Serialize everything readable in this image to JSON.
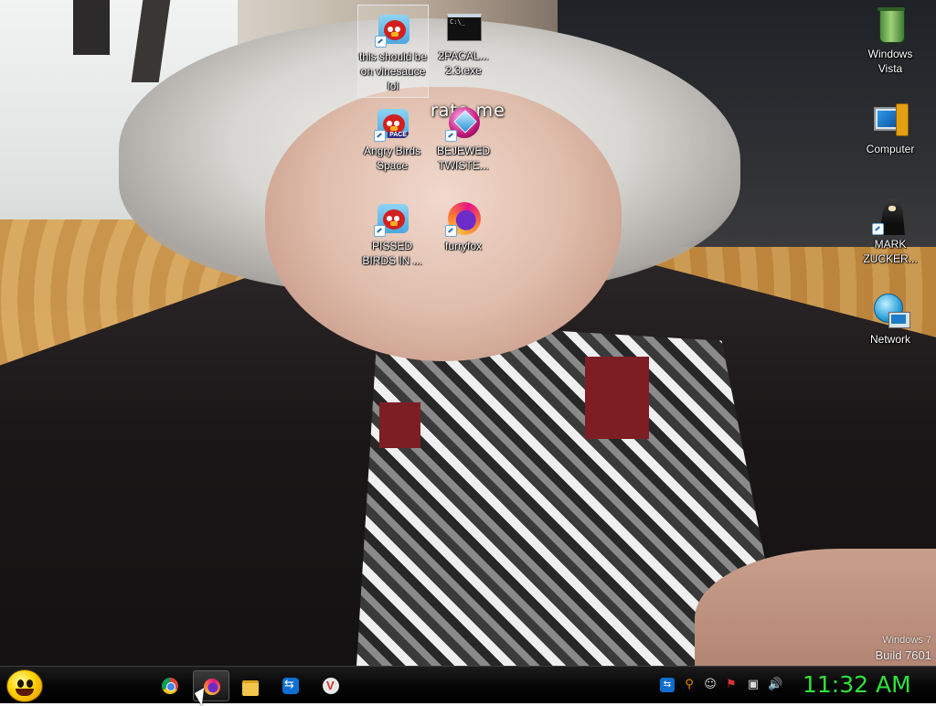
{
  "wallpaper": {
    "caption": "rate me"
  },
  "desktop": {
    "icons": [
      {
        "label": "this should be on vinesauce lol",
        "icon": "angry-birds-icon"
      },
      {
        "label": "2PACAL... 2.3.exe",
        "icon": "console-app-icon"
      },
      {
        "label": "Angry Birds Space",
        "icon": "angry-birds-space-icon",
        "tag": "PACE"
      },
      {
        "label": "BEJEWED TWISTE...",
        "icon": "bejeweled-icon"
      },
      {
        "label": "PISSED BIRDS IN ...",
        "icon": "angry-birds-icon"
      },
      {
        "label": "furryfox",
        "icon": "firefox-icon"
      },
      {
        "label": "Windows Vista",
        "icon": "recycle-bin-icon"
      },
      {
        "label": "Computer",
        "icon": "computer-icon"
      },
      {
        "label": "MARK ZUCKER...",
        "icon": "figure-icon"
      },
      {
        "label": "Network",
        "icon": "network-icon"
      }
    ],
    "console_text": "C:\\_"
  },
  "watermark": {
    "os": "Windows 7",
    "build": "Build 7601"
  },
  "taskbar": {
    "pinned": [
      {
        "name": "chrome",
        "icon": "chrome-icon"
      },
      {
        "name": "firefox",
        "icon": "firefox-icon",
        "active": true
      },
      {
        "name": "explorer",
        "icon": "folder-icon"
      },
      {
        "name": "teamviewer",
        "icon": "teamviewer-icon"
      },
      {
        "name": "vivaldi",
        "icon": "vivaldi-icon"
      }
    ],
    "tray": [
      "teamviewer-icon",
      "search-icon",
      "chat-icon",
      "action-center-flag-icon",
      "network-icon",
      "volume-icon"
    ],
    "clock": "11:32 AM",
    "clock_color": "#2ee23a"
  }
}
